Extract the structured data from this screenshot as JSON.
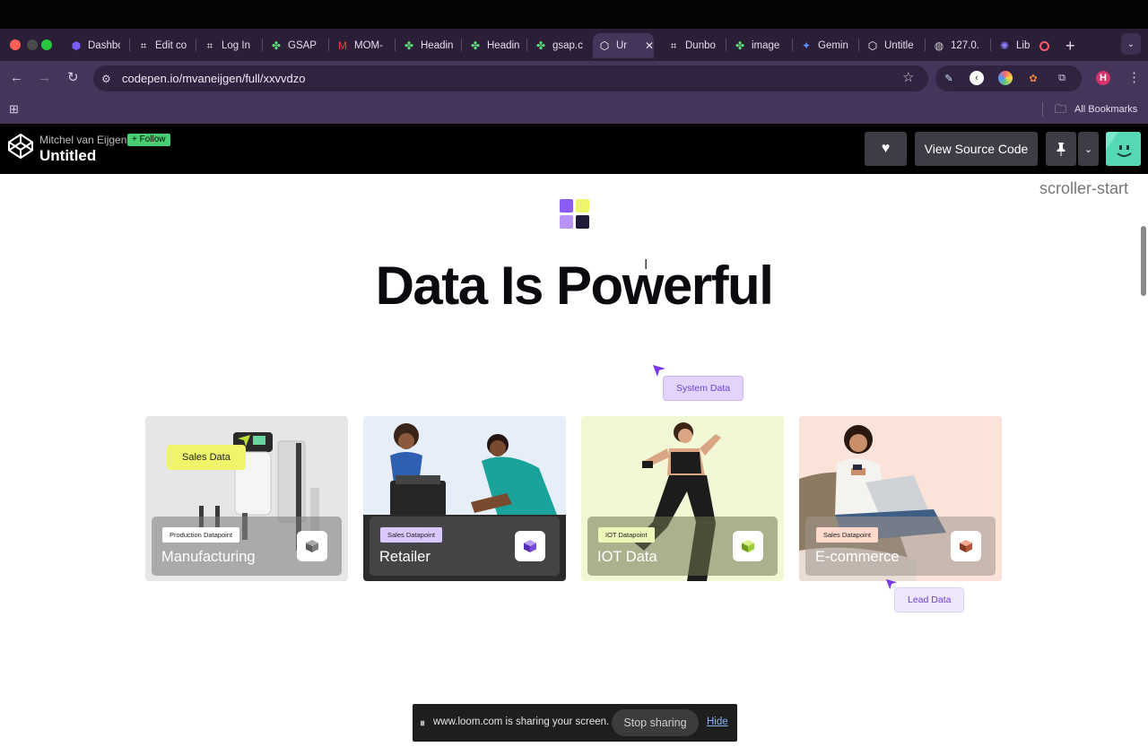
{
  "browser": {
    "tabs": [
      {
        "label": "Dashbo",
        "icon": "hexagon-icon",
        "color": "#7c5cff"
      },
      {
        "label": "Edit co",
        "icon": "grid-icon",
        "color": "#e6e6e6"
      },
      {
        "label": "Log In",
        "icon": "grid-icon",
        "color": "#e6e6e6"
      },
      {
        "label": "GSAP",
        "icon": "clover-icon",
        "color": "#5fe07a"
      },
      {
        "label": "MOM-",
        "icon": "gmail-icon",
        "color": "#ea4335"
      },
      {
        "label": "Headin",
        "icon": "clover-icon",
        "color": "#5fe07a"
      },
      {
        "label": "Headin",
        "icon": "clover-icon",
        "color": "#5fe07a"
      },
      {
        "label": "gsap.c",
        "icon": "clover-icon",
        "color": "#5fe07a"
      },
      {
        "label": "Un",
        "icon": "codepen-icon",
        "color": "#ffffff"
      },
      {
        "label": "Dunbo",
        "icon": "grid-icon",
        "color": "#e6e6e6"
      },
      {
        "label": "image",
        "icon": "clover-icon",
        "color": "#5fe07a"
      },
      {
        "label": "Gemin",
        "icon": "sparkle-icon",
        "color": "#5b8cff"
      },
      {
        "label": "Untitle",
        "icon": "codepen-icon",
        "color": "#ffffff"
      },
      {
        "label": "127.0.",
        "icon": "globe-icon",
        "color": "#cfcfcf"
      },
      {
        "label": "Lib",
        "icon": "gear-icon",
        "color": "#8f7bff"
      }
    ],
    "url": "codepen.io/mvaneijgen/full/xxvvdzo",
    "bookmarks_label": "All Bookmarks",
    "profile_initial": "H"
  },
  "codepen": {
    "author": "Mitchel van Eijgen",
    "follow_label": "+ Follow",
    "pen_title": "Untitled",
    "view_source_label": "View Source Code"
  },
  "page": {
    "scroller_label": "scroller-start",
    "headline": "Data Is Powerful",
    "tags": {
      "system": "System Data",
      "sales": "Sales Data",
      "lead": "Lead Data"
    },
    "cards": [
      {
        "chip": "Production Datapoint",
        "title": "Manufacturing",
        "chip_color": "#ffffff",
        "cube_color": "#6e6e6e"
      },
      {
        "chip": "Sales Datapoint",
        "title": "Retailer",
        "chip_color": "#d9c7ff",
        "cube_color": "#7a4fd6"
      },
      {
        "chip": "IOT Datapoint",
        "title": "IOT Data",
        "chip_color": "#eef7b9",
        "cube_color": "#9ccf3a"
      },
      {
        "chip": "Sales Datapoint",
        "title": "E-commerce",
        "chip_color": "#ffd9cc",
        "cube_color": "#b5553a"
      }
    ]
  },
  "loom": {
    "message": "www.loom.com is sharing your screen.",
    "stop_label": "Stop sharing",
    "hide_label": "Hide"
  }
}
